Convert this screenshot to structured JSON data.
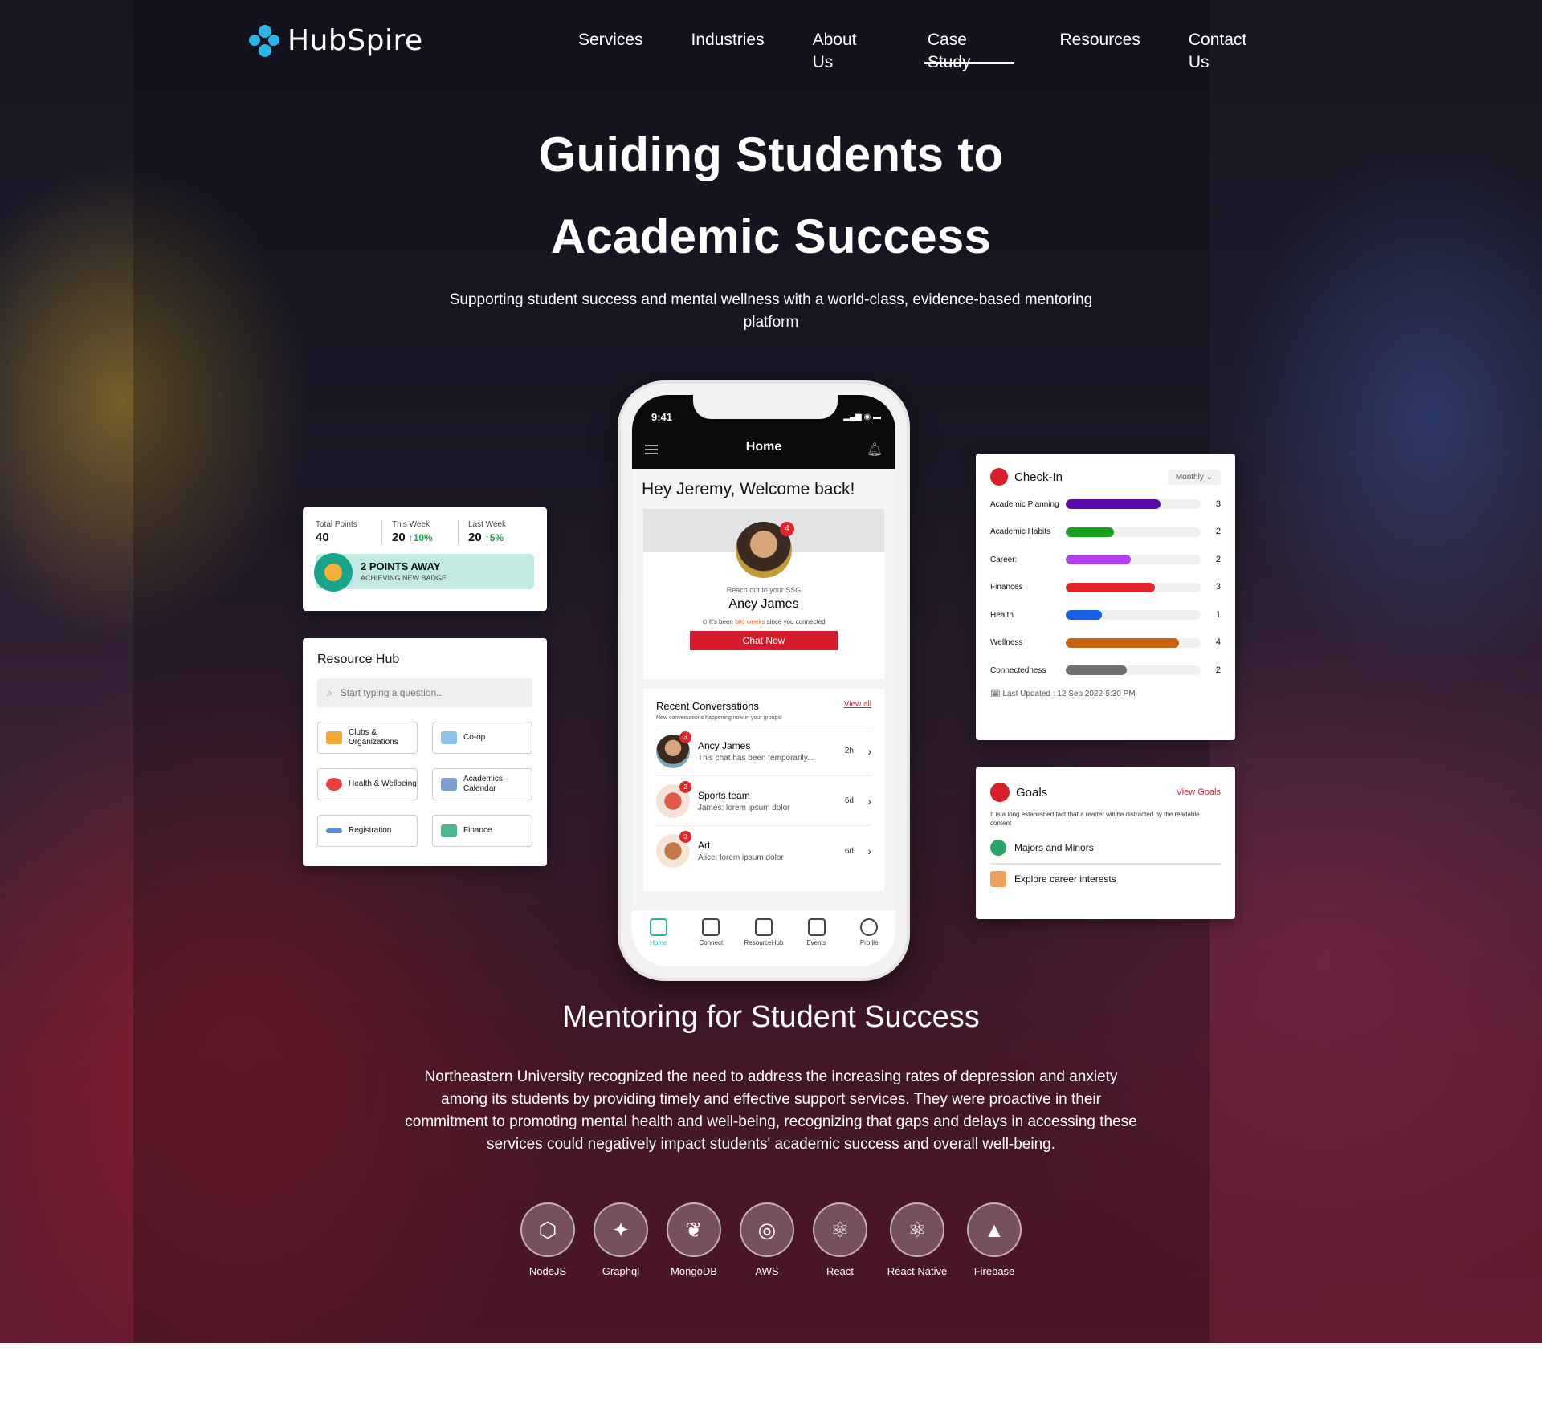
{
  "brand": {
    "name": "HubSpire"
  },
  "nav": {
    "items": [
      "Services",
      "Industries",
      "About Us",
      "Case Study",
      "Resources",
      "Contact Us"
    ],
    "active": "Case Study"
  },
  "hero": {
    "title_line1": "Guiding Students to",
    "title_line2": "Academic Success",
    "subtitle": "Supporting student success and mental wellness with a world-class, evidence-based mentoring platform"
  },
  "points": {
    "total_label": "Total Points",
    "total_value": "40",
    "week_label": "This Week",
    "week_value": "20",
    "week_change": "↑10%",
    "last_label": "Last Week",
    "last_value": "20",
    "last_change": "↑5%",
    "badge_title": "2  POINTS AWAY",
    "badge_sub": "ACHIEVING NEW BADGE"
  },
  "resource_hub": {
    "title": "Resource Hub",
    "placeholder": "Start typing a question...",
    "tiles": [
      "Clubs & Organizations",
      "Co-op",
      "Health & Wellbeing",
      "Academics Calendar",
      "Registration",
      "Finance"
    ]
  },
  "phone": {
    "time": "9:41",
    "title": "Home",
    "welcome": "Hey Jeremy, Welcome back!",
    "mentor_badge": "4",
    "reach": "Reach out to your SSG",
    "mentor_name": "Ancy James",
    "since_pre": "It's been ",
    "since_hl": "two weeks",
    "since_post": " since you connected",
    "chat_btn": "Chat Now",
    "recent_title": "Recent Conversations",
    "view_all": "View all",
    "recent_sub": "New conversations happening now in your groups!",
    "conversations": [
      {
        "name": "Ancy James",
        "msg": "This chat has been temporarily...",
        "time": "2h",
        "badge": "3"
      },
      {
        "name": "Sports team",
        "msg": "James: lorem ipsum dolor",
        "time": "6d",
        "badge": "2"
      },
      {
        "name": "Art",
        "msg": "Alice: lorem ipsum dolor",
        "time": "6d",
        "badge": "3"
      }
    ],
    "tabs": [
      "Home",
      "Connect",
      "ResourceHub",
      "Events",
      "Profile"
    ]
  },
  "checkin": {
    "title": "Check-In",
    "period": "Monthly",
    "rows": [
      {
        "label": "Academic Planning",
        "value": 3,
        "fill": 0.7,
        "color": "#5a0aa8"
      },
      {
        "label": "Academic Habits",
        "value": 2,
        "fill": 0.36,
        "color": "#19a01c"
      },
      {
        "label": "Career:",
        "value": 2,
        "fill": 0.48,
        "color": "#b040f0"
      },
      {
        "label": "Finances",
        "value": 3,
        "fill": 0.66,
        "color": "#e0262b"
      },
      {
        "label": "Health",
        "value": 1,
        "fill": 0.27,
        "color": "#1660e8"
      },
      {
        "label": "Wellness",
        "value": 4,
        "fill": 0.84,
        "color": "#c7620e"
      },
      {
        "label": "Connectedness",
        "value": 2,
        "fill": 0.45,
        "color": "#6f6f6f"
      }
    ],
    "updated": "Last Updated : 12 Sep 2022-5:30 PM"
  },
  "goals": {
    "title": "Goals",
    "link": "View Goals",
    "desc": "It is a long established fact that a reader will be distracted by the readable content",
    "items": [
      "Majors and Minors",
      "Explore career interests"
    ]
  },
  "section": {
    "title": "Mentoring for Student Success",
    "body": "Northeastern University recognized the need to address the increasing rates of depression and anxiety among its students by providing timely and effective support services. They were proactive in their commitment to promoting mental health and well-being, recognizing that gaps and delays in accessing these services could negatively impact students' academic success and overall well-being."
  },
  "tech": [
    {
      "name": "NodeJS",
      "icon": "nodejs-icon",
      "glyph": "⬡"
    },
    {
      "name": "Graphql",
      "icon": "graphql-icon",
      "glyph": "✦"
    },
    {
      "name": "MongoDB",
      "icon": "mongodb-icon",
      "glyph": "❦"
    },
    {
      "name": "AWS",
      "icon": "aws-icon",
      "glyph": "◎"
    },
    {
      "name": "React",
      "icon": "react-icon",
      "glyph": "⚛"
    },
    {
      "name": "React Native",
      "icon": "react-native-icon",
      "glyph": "⚛"
    },
    {
      "name": "Firebase",
      "icon": "firebase-icon",
      "glyph": "▲"
    }
  ]
}
